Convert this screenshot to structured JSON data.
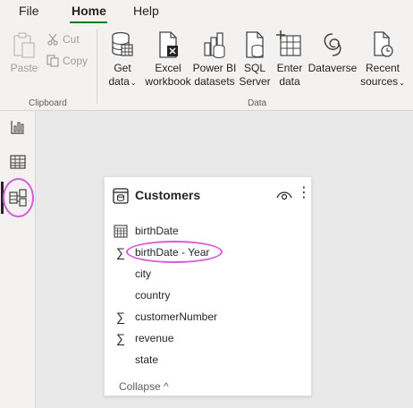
{
  "menu": {
    "file": "File",
    "home": "Home",
    "help": "Help"
  },
  "ribbon": {
    "clipboard": {
      "paste": "Paste",
      "cut": "Cut",
      "copy": "Copy",
      "group_label": "Clipboard"
    },
    "data": {
      "get_data_1": "Get",
      "get_data_2": "data",
      "excel_1": "Excel",
      "excel_2": "workbook",
      "powerbi_1": "Power BI",
      "powerbi_2": "datasets",
      "sql_1": "SQL",
      "sql_2": "Server",
      "enter_1": "Enter",
      "enter_2": "data",
      "dataverse": "Dataverse",
      "recent_1": "Recent",
      "recent_2": "sources",
      "group_label": "Data"
    }
  },
  "left_rail": {
    "icons": [
      "report-view-icon",
      "data-view-icon",
      "model-view-icon"
    ],
    "active": "model-view-icon"
  },
  "table_card": {
    "title": "Customers",
    "fields": [
      {
        "label": "birthDate",
        "icon": "calendar-icon"
      },
      {
        "label": "birthDate - Year",
        "icon": "sigma-icon"
      },
      {
        "label": "city",
        "icon": ""
      },
      {
        "label": "country",
        "icon": ""
      },
      {
        "label": "customerNumber",
        "icon": "sigma-icon"
      },
      {
        "label": "revenue",
        "icon": "sigma-icon"
      },
      {
        "label": "state",
        "icon": ""
      }
    ],
    "collapse_label": "Collapse",
    "collapse_glyph": "^"
  },
  "colors": {
    "highlight": "#d85cd8",
    "accent": "#107c10"
  }
}
